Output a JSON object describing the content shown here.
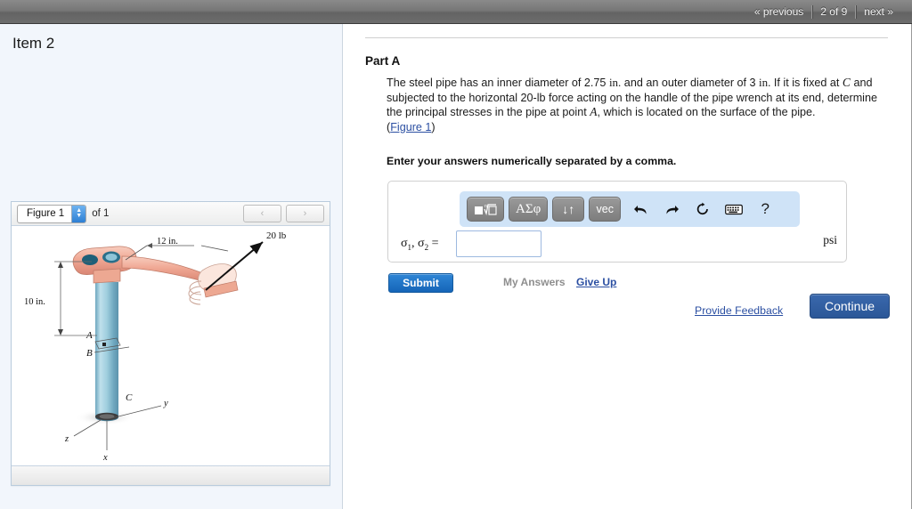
{
  "topbar": {
    "previous_label": "« previous",
    "page_indicator": "2 of 9",
    "next_label": "next »"
  },
  "sidebar": {
    "item_title": "Item 2",
    "figure_widget": {
      "selected_figure": "Figure 1",
      "of_label": "of 1",
      "prev_arrow": "‹",
      "next_arrow": "›"
    }
  },
  "figure": {
    "force_label": "20 lb",
    "handle_length_label": "12 in.",
    "pipe_length_label": "10 in.",
    "point_a": "A",
    "point_b": "B",
    "point_c": "C",
    "axis_x": "x",
    "axis_y": "y",
    "axis_z": "z",
    "pipe_color": "#8fc3d8",
    "wrench_color": "#f0a894"
  },
  "main": {
    "part_title": "Part A",
    "question": {
      "l1_a": "The steel pipe has an inner diameter of 2.75 ",
      "l1_unit1": "in.",
      "l1_b": " and an outer diameter of 3 ",
      "l1_unit2": "in.",
      "l1_c": " If it is fixed at ",
      "l1_var": "C",
      "l2": "and subjected to the horizontal 20-lb force acting on the handle of the pipe wrench at its end,",
      "l3_a": "determine the principal stresses in the pipe at point ",
      "l3_var": "A",
      "l3_b": ", which is located on the surface of the",
      "l4": "pipe.",
      "figure_link": "Figure 1"
    },
    "instruction": "Enter your answers numerically separated by a comma.",
    "math_toolbar": {
      "template_button": "template-icon",
      "greek_button": "ΑΣφ",
      "arrows_button": "↓↑",
      "vec_button": "vec",
      "undo_icon": "undo-icon",
      "redo_icon": "redo-icon",
      "reset_icon": "reset-icon",
      "keyboard_icon": "keyboard-icon",
      "help_icon": "?"
    },
    "answer": {
      "label_sigma1": "σ",
      "label_sub1": "1",
      "label_comma": ", σ",
      "label_sub2": "2",
      "label_equals": " =",
      "value": "",
      "placeholder": "",
      "unit": "psi"
    },
    "actions": {
      "submit_label": "Submit",
      "my_answers_label": "My Answers",
      "give_up_label": "Give Up",
      "provide_feedback_label": "Provide Feedback",
      "continue_label": "Continue"
    }
  },
  "colors": {
    "submit_blue": "#1565b8",
    "continue_blue": "#2b5797",
    "link_blue": "#2b4fa2",
    "toolbar_bg": "#cfe3f7",
    "sidebar_bg": "#f2f6fc",
    "topbar_gray": "#6d6d6d"
  }
}
